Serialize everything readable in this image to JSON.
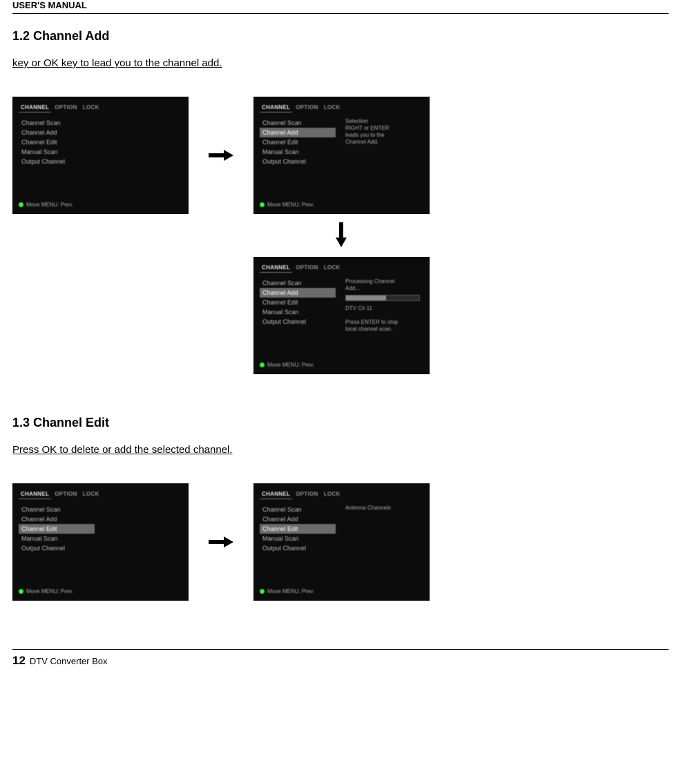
{
  "header": {
    "running_title": "USER'S MANUAL"
  },
  "section12": {
    "heading": "1.2 Channel Add",
    "instruction": "key or OK key to lead you to the channel add.",
    "screens": {
      "a": {
        "tabs": {
          "channel": "CHANNEL",
          "option": "OPTION",
          "lock": "LOCK"
        },
        "menu": [
          "Channel Scan",
          "Channel Add",
          "Channel Edit",
          "Manual Scan",
          "Output Channel"
        ],
        "active_tab": "channel",
        "footnote": "Move  MENU: Prev."
      },
      "b": {
        "tabs": {
          "channel": "CHANNEL",
          "option": "OPTION",
          "lock": "LOCK"
        },
        "menu": [
          "Channel Scan",
          "Channel Add",
          "Channel Edit",
          "Manual Scan",
          "Output Channel"
        ],
        "selected": "Channel Add",
        "side": "Selection\nRIGHT or ENTER\nleads you to the\nChannel Add.",
        "footnote": "Move  MENU: Prev."
      },
      "c": {
        "tabs": {
          "channel": "CHANNEL",
          "option": "OPTION",
          "lock": "LOCK"
        },
        "menu": [
          "Channel Scan",
          "Channel Add",
          "Channel Edit",
          "Manual Scan",
          "Output Channel"
        ],
        "selected": "Channel Add",
        "side_title": "Processing Channel\nAdd...",
        "side_sub1": "DTV Ch 11",
        "side_sub2": "Press ENTER to stop\nlocal channel scan.",
        "footnote": "Move  MENU: Prev."
      }
    }
  },
  "section13": {
    "heading": "1.3 Channel Edit",
    "instruction": "Press OK to delete or add the selected channel.",
    "screens": {
      "a": {
        "tabs": {
          "channel": "CHANNEL",
          "option": "OPTION",
          "lock": "LOCK"
        },
        "menu": [
          "Channel Scan",
          "Channel Add",
          "Channel Edit",
          "Manual Scan",
          "Output Channel"
        ],
        "selected": "Channel Edit",
        "footnote": "Move  MENU: Prev."
      },
      "b": {
        "tabs": {
          "channel": "CHANNEL",
          "option": "OPTION",
          "lock": "LOCK"
        },
        "menu": [
          "Channel Scan",
          "Channel Add",
          "Channel Edit",
          "Manual Scan",
          "Output Channel"
        ],
        "selected": "Channel Edit",
        "side": "Antenna Channels",
        "footnote": "Move  MENU: Prev."
      }
    }
  },
  "footer": {
    "page_number": "12",
    "product": "DTV Converter Box"
  }
}
